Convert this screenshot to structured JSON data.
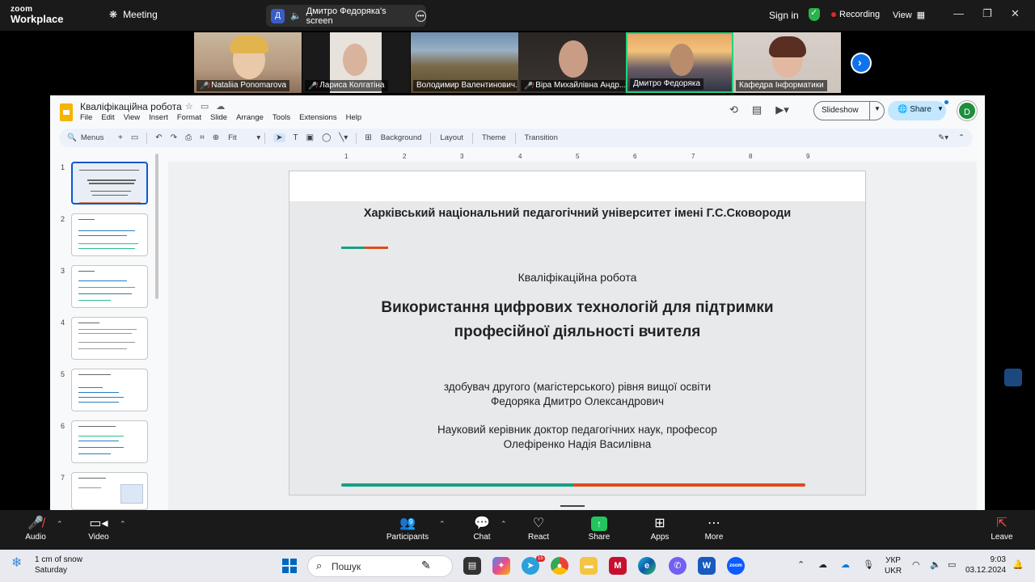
{
  "zoom": {
    "logo_line1": "zoom",
    "logo_line2": "Workplace",
    "meeting_label": "Meeting",
    "screen_share_initial": "Д",
    "screen_share_name": "Дмитро Федоряка's screen",
    "sign_in": "Sign in",
    "recording": "Recording",
    "view": "View",
    "participants": [
      {
        "name": "Nataliia Ponomarova",
        "muted": true
      },
      {
        "name": "Лариса Колгатіна",
        "muted": true
      },
      {
        "name": "Володимир Валентинович...",
        "muted": false
      },
      {
        "name": "Віра Михайлівна Андр...",
        "muted": true
      },
      {
        "name": "Дмитро Федоряка",
        "muted": false,
        "active": true
      },
      {
        "name": "Кафедра Інформатики",
        "muted": false
      }
    ],
    "bottom": {
      "audio": "Audio",
      "video": "Video",
      "participants": "Participants",
      "participants_count": "9",
      "chat": "Chat",
      "react": "React",
      "share": "Share",
      "apps": "Apps",
      "more": "More",
      "leave": "Leave"
    }
  },
  "slides_app": {
    "title": "Кваліфікаційна робота",
    "menu": [
      "File",
      "Edit",
      "View",
      "Insert",
      "Format",
      "Slide",
      "Arrange",
      "Tools",
      "Extensions",
      "Help"
    ],
    "slideshow": "Slideshow",
    "share": "Share",
    "user_initial": "D",
    "toolbar": {
      "menus": "Menus",
      "zoom": "Fit",
      "background": "Background",
      "layout": "Layout",
      "theme": "Theme",
      "transition": "Transition"
    },
    "ruler_numbers": [
      "1",
      "2",
      "3",
      "4",
      "5",
      "6",
      "7",
      "8",
      "9"
    ],
    "thumb_numbers": [
      "1",
      "2",
      "3",
      "4",
      "5",
      "6",
      "7"
    ]
  },
  "slide": {
    "university": "Харківський національний педагогічний університет імені Г.С.Сковороди",
    "subtitle": "Кваліфікаційна робота",
    "title_line1": "Використання цифрових технологій для підтримки",
    "title_line2": "професійної діяльності вчителя",
    "author_line1": "здобувач другого (магістерського) рівня вищої освіти",
    "author_line2": "Федоряка Дмитро Олександрович",
    "supervisor_line1": "Науковий керівник доктор педагогічних наук, професор",
    "supervisor_line2": "Олефіренко Надія Василівна",
    "accent_colors": {
      "teal": "#19a082",
      "orange": "#e04a1a"
    }
  },
  "taskbar": {
    "weather_line1": "1 cm of snow",
    "weather_line2": "Saturday",
    "search": "Пошук",
    "lang_line1": "УКР",
    "lang_line2": "UKR",
    "time": "9:03",
    "date": "03.12.2024",
    "telegram_badge": "15"
  }
}
